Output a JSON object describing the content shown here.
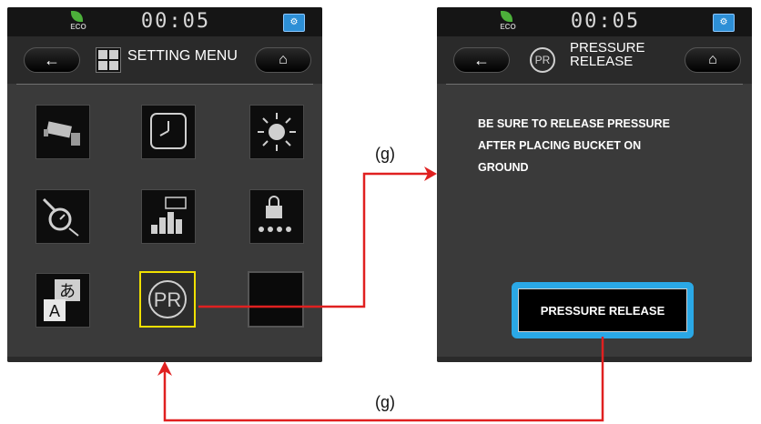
{
  "left_screen": {
    "eco_label": "ECO",
    "clock": "00:05",
    "back_icon": "←",
    "home_icon": "⌂",
    "title": "SETTING MENU",
    "tiles": [
      {
        "icon": "camera-icon"
      },
      {
        "icon": "clock-icon"
      },
      {
        "icon": "brightness-icon"
      },
      {
        "icon": "maintenance-icon"
      },
      {
        "icon": "hydraulic-icon"
      },
      {
        "icon": "password-icon"
      },
      {
        "icon": "language-icon",
        "text_a": "あ",
        "text_b": "A"
      },
      {
        "icon": "pressure-release-icon",
        "text": "PR"
      },
      {
        "icon": "empty"
      }
    ]
  },
  "right_screen": {
    "eco_label": "ECO",
    "clock": "00:05",
    "back_icon": "←",
    "home_icon": "⌂",
    "pr_icon_text": "PR",
    "title_line1": "PRESSURE",
    "title_line2": "RELEASE",
    "message_lines": [
      "BE SURE TO RELEASE PRESSURE",
      "AFTER PLACING BUCKET ON",
      "GROUND"
    ],
    "button_label": "PRESSURE RELEASE"
  },
  "annotations": {
    "top_label": "(g)",
    "bottom_label": "(g)"
  },
  "colors": {
    "screen_bg": "#3a3a3a",
    "highlight_yellow": "#f0e000",
    "highlight_blue": "#2aa8e6",
    "arrow_red": "#e02020",
    "eco_green": "#4caf3a"
  }
}
